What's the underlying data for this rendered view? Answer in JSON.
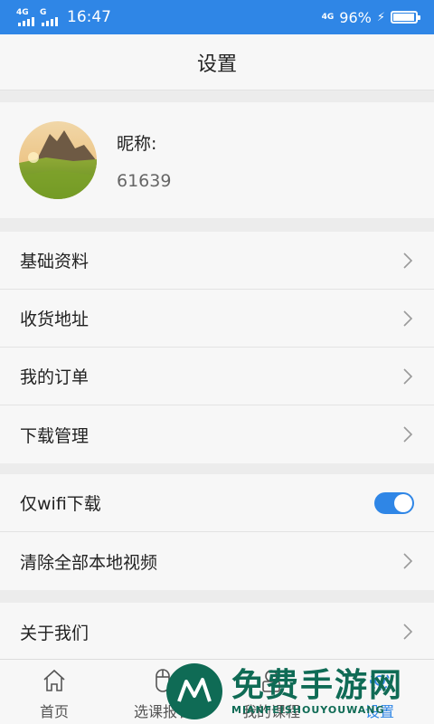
{
  "status_bar": {
    "network_left_1": "4G",
    "network_left_2": "G",
    "time": "16:47",
    "network_right": "4G",
    "battery_text": "96%",
    "battery_level": 0.96
  },
  "header": {
    "title": "设置"
  },
  "profile": {
    "nickname_label": "昵称:",
    "user_id": "61639"
  },
  "menu_group_1": [
    {
      "label": "基础资料"
    },
    {
      "label": "收货地址"
    },
    {
      "label": "我的订单"
    },
    {
      "label": "下载管理"
    }
  ],
  "menu_group_2": {
    "wifi_only_label": "仅wifi下载",
    "wifi_only_enabled": true,
    "clear_videos_label": "清除全部本地视频"
  },
  "menu_group_3": {
    "about_label": "关于我们"
  },
  "tabbar": {
    "tabs": [
      {
        "label": "首页",
        "icon": "home-icon"
      },
      {
        "label": "选课报名",
        "icon": "mouse-icon"
      },
      {
        "label": "我的课程",
        "icon": "course-icon"
      },
      {
        "label": "设置",
        "icon": "gear-icon",
        "active": true
      }
    ]
  },
  "watermark": {
    "main": "免费手游网",
    "sub": "MIANFEISHOUYOUWANG"
  },
  "colors": {
    "accent": "#2f86e6",
    "watermark": "#0f6b55"
  }
}
